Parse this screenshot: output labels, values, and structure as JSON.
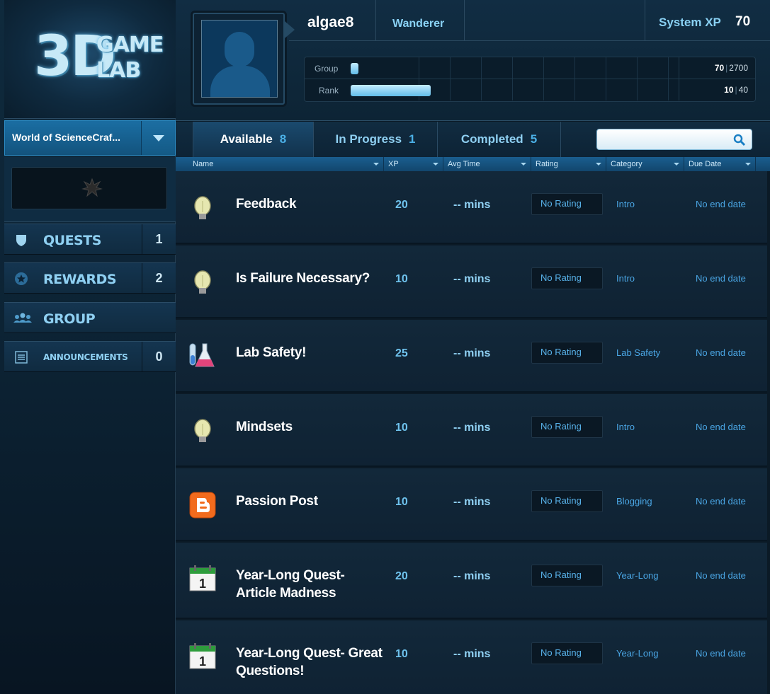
{
  "logo": {
    "big": "3D",
    "line1": "GAME",
    "line2": "LAB"
  },
  "course": {
    "label": "World of ScienceCraf..."
  },
  "nav": [
    {
      "label": "QUESTS",
      "count": "1",
      "icon": "shield-icon"
    },
    {
      "label": "REWARDS",
      "count": "2",
      "icon": "star-badge-icon"
    },
    {
      "label": "GROUP",
      "count": "",
      "icon": "group-icon"
    },
    {
      "label": "ANNOUNCEMENTS",
      "count": "0",
      "icon": "list-icon"
    }
  ],
  "user": {
    "name": "algae8",
    "rank_title": "Wanderer",
    "system_xp_label": "System XP",
    "system_xp": "70"
  },
  "progress": {
    "group": {
      "label": "Group",
      "current": "70",
      "max": "2700",
      "fraction": 0.026
    },
    "rank": {
      "label": "Rank",
      "current": "10",
      "max": "40",
      "fraction": 0.25
    }
  },
  "tabs": [
    {
      "label": "Available",
      "count": "8"
    },
    {
      "label": "In Progress",
      "count": "1"
    },
    {
      "label": "Completed",
      "count": "5"
    }
  ],
  "search": {
    "placeholder": ""
  },
  "columns": [
    "Name",
    "XP",
    "Avg Time",
    "Rating",
    "Category",
    "Due Date"
  ],
  "quests": [
    {
      "icon": "lightbulb-icon",
      "name": "Feedback",
      "xp": "20",
      "time": "-- mins",
      "rating": "No Rating",
      "category": "Intro",
      "due": "No end date"
    },
    {
      "icon": "lightbulb-icon",
      "name": "Is Failure Necessary?",
      "xp": "10",
      "time": "-- mins",
      "rating": "No Rating",
      "category": "Intro",
      "due": "No end date"
    },
    {
      "icon": "lab-flask-icon",
      "name": "Lab Safety!",
      "xp": "25",
      "time": "-- mins",
      "rating": "No Rating",
      "category": "Lab Safety",
      "due": "No end date"
    },
    {
      "icon": "lightbulb-icon",
      "name": "Mindsets",
      "xp": "10",
      "time": "-- mins",
      "rating": "No Rating",
      "category": "Intro",
      "due": "No end date"
    },
    {
      "icon": "blogger-icon",
      "name": "Passion Post",
      "xp": "10",
      "time": "-- mins",
      "rating": "No Rating",
      "category": "Blogging",
      "due": "No end date"
    },
    {
      "icon": "calendar-icon",
      "name": "Year-Long Quest- Article Madness",
      "xp": "20",
      "time": "-- mins",
      "rating": "No Rating",
      "category": "Year-Long",
      "due": "No end date"
    },
    {
      "icon": "calendar-icon",
      "name": "Year-Long Quest- Great Questions!",
      "xp": "10",
      "time": "-- mins",
      "rating": "No Rating",
      "category": "Year-Long",
      "due": "No end date"
    }
  ]
}
